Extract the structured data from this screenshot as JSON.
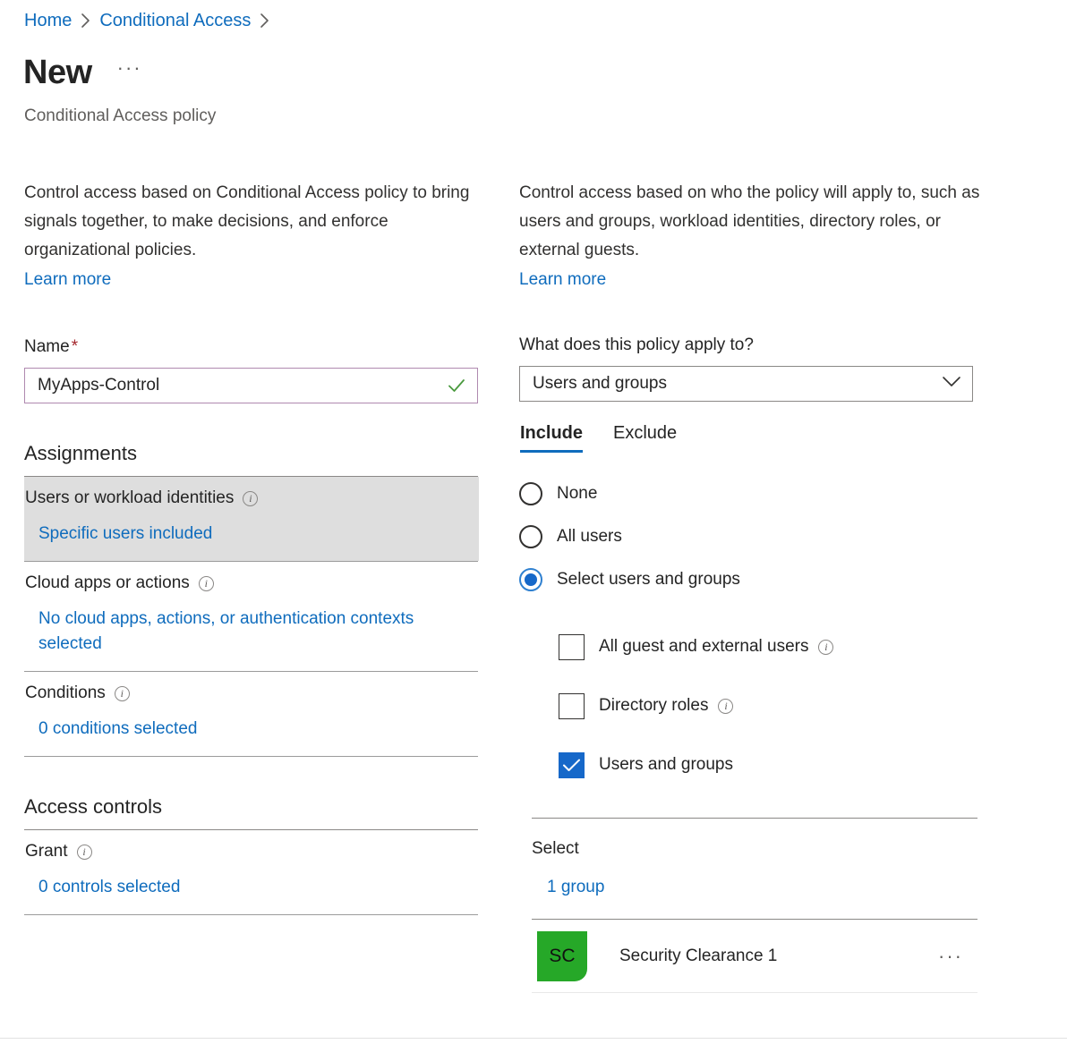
{
  "breadcrumb": {
    "items": [
      {
        "label": "Home"
      },
      {
        "label": "Conditional Access"
      }
    ]
  },
  "header": {
    "title": "New",
    "ellipsis": "···",
    "subtitle": "Conditional Access policy"
  },
  "left": {
    "description": "Control access based on Conditional Access policy to bring signals together, to make decisions, and enforce organizational policies.",
    "learn_more": "Learn more",
    "name_label": "Name",
    "name_required_mark": "*",
    "name_value": "MyApps-Control",
    "name_placeholder": "",
    "assignments_heading": "Assignments",
    "rows": [
      {
        "title": "Users or workload identities",
        "value": "Specific users included",
        "selected": true
      },
      {
        "title": "Cloud apps or actions",
        "value": "No cloud apps, actions, or authentication contexts selected",
        "selected": false
      },
      {
        "title": "Conditions",
        "value": "0 conditions selected",
        "selected": false
      }
    ],
    "access_controls_heading": "Access controls",
    "grant_title": "Grant",
    "grant_value": "0 controls selected"
  },
  "right": {
    "description": "Control access based on who the policy will apply to, such as users and groups, workload identities, directory roles, or external guests.",
    "learn_more": "Learn more",
    "apply_to_label": "What does this policy apply to?",
    "apply_to_value": "Users and groups",
    "tabs": [
      {
        "label": "Include",
        "active": true
      },
      {
        "label": "Exclude",
        "active": false
      }
    ],
    "radios": [
      {
        "label": "None",
        "checked": false
      },
      {
        "label": "All users",
        "checked": false
      },
      {
        "label": "Select users and groups",
        "checked": true
      }
    ],
    "checkboxes": [
      {
        "label": "All guest and external users",
        "checked": false,
        "info": true
      },
      {
        "label": "Directory roles",
        "checked": false,
        "info": true
      },
      {
        "label": "Users and groups",
        "checked": true,
        "info": false
      }
    ],
    "select_label": "Select",
    "select_value": "1 group",
    "groups": [
      {
        "initials": "SC",
        "name": "Security Clearance 1",
        "menu": "···"
      }
    ]
  },
  "colors": {
    "link": "#0f6cbd",
    "accent": "#1668c9",
    "required": "#a4262c",
    "input_border_focus": "#b089b0",
    "valid_check": "#4a9a3f",
    "avatar_green": "#26a828",
    "selected_row_bg": "#dedede"
  }
}
